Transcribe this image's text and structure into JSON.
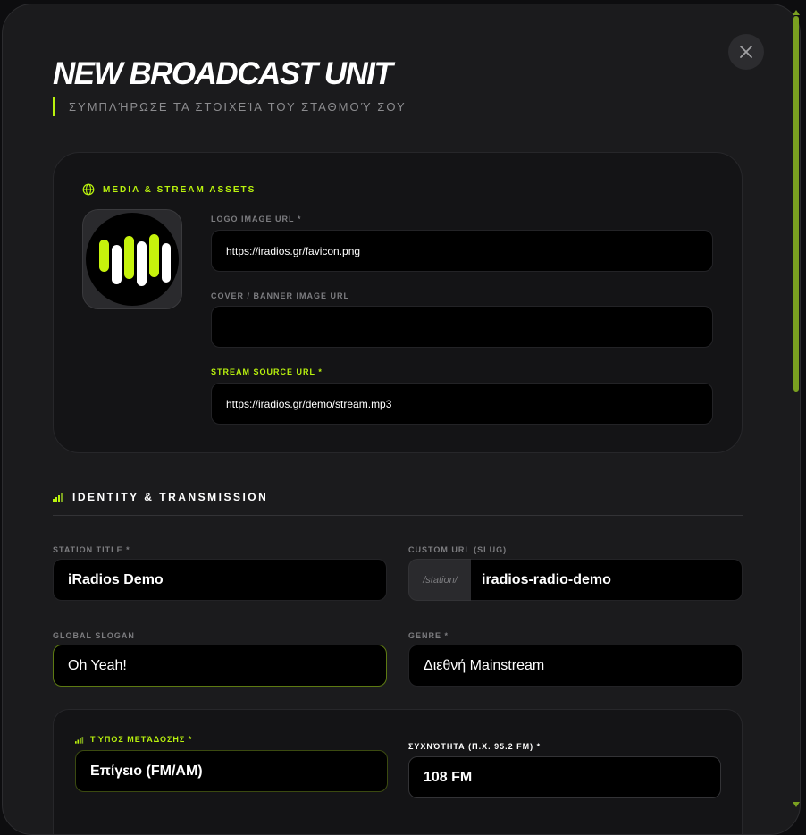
{
  "modal": {
    "title": "NEW BROADCAST UNIT",
    "subtitle": "ΣΥΜΠΛΉΡΩΣΕ ΤΑ ΣΤΟΙΧΕΊΑ ΤΟΥ ΣΤΑΘΜΟΎ ΣΟΥ"
  },
  "media": {
    "heading": "MEDIA & STREAM ASSETS",
    "logo_label": "LOGO IMAGE URL *",
    "logo_value": "https://iradios.gr/favicon.png",
    "cover_label": "COVER / BANNER IMAGE URL",
    "cover_value": "",
    "stream_label": "STREAM SOURCE URL *",
    "stream_value": "https://iradios.gr/demo/stream.mp3"
  },
  "identity": {
    "heading": "IDENTITY & TRANSMISSION",
    "station_title_label": "STATION TITLE *",
    "station_title_value": "iRadios Demo",
    "slug_label": "CUSTOM URL (SLUG)",
    "slug_prefix": "/station/",
    "slug_value": "iradios-radio-demo",
    "slogan_label": "GLOBAL SLOGAN",
    "slogan_value": "Oh Yeah!",
    "genre_label": "GENRE *",
    "genre_value": "Διεθνή Mainstream"
  },
  "transmission": {
    "type_label": "ΤΎΠΟΣ ΜΕΤΆΔΟΣΗΣ *",
    "type_value": "Επίγειο (FM/AM)",
    "freq_label": "ΣΥΧΝΌΤΗΤΑ (Π.Χ. 95.2 FM) *",
    "freq_value": "108 FM"
  },
  "colors": {
    "accent": "#b9f20e",
    "background": "#1b1b1d",
    "input": "#000000"
  }
}
